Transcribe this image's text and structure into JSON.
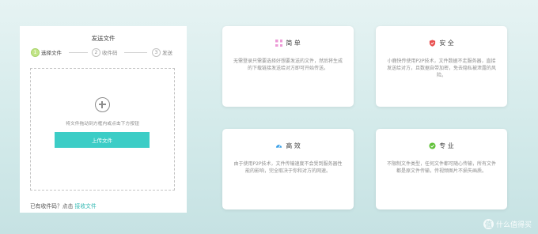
{
  "panel": {
    "title": "发送文件",
    "steps": [
      {
        "num": "1",
        "label": "选择文件"
      },
      {
        "num": "2",
        "label": "收件码"
      },
      {
        "num": "3",
        "label": "发送"
      }
    ],
    "active_step": 1,
    "drop_hint": "将文件拖动到方框内或点击下方按钮",
    "upload_button": "上传文件",
    "receive_prompt": "已有收件码？点击",
    "receive_link": "接收文件"
  },
  "features": [
    {
      "icon": "grid-icon",
      "color": "#ec9ad6",
      "title": "简 单",
      "body": "无需登录只需要选择好想要发送的文件，然后将生成的下载链接发送给对方即可开始传送。"
    },
    {
      "icon": "shield-icon",
      "color": "#e85050",
      "title": "安 全",
      "body": "小鹿快传使用P2P技术，文件数据不走服务器，直接发送给对方，且数据自带加密，免去隐私被泄露的风险。"
    },
    {
      "icon": "speed-gauge-icon",
      "color": "#3aa0e8",
      "title": "高 效",
      "body": "由于使用P2P技术，文件传输速度不会受到服务器性能的影响，完全取决于你和对方的网速。"
    },
    {
      "icon": "check-circle-icon",
      "color": "#62c23a",
      "title": "专 业",
      "body": "不限制文件类型，任何文件都可随心传输，所有文件都是原文件传输，传视频图片不损失画质。"
    }
  ],
  "watermark": {
    "logo": "值",
    "text": "什么值得买"
  }
}
